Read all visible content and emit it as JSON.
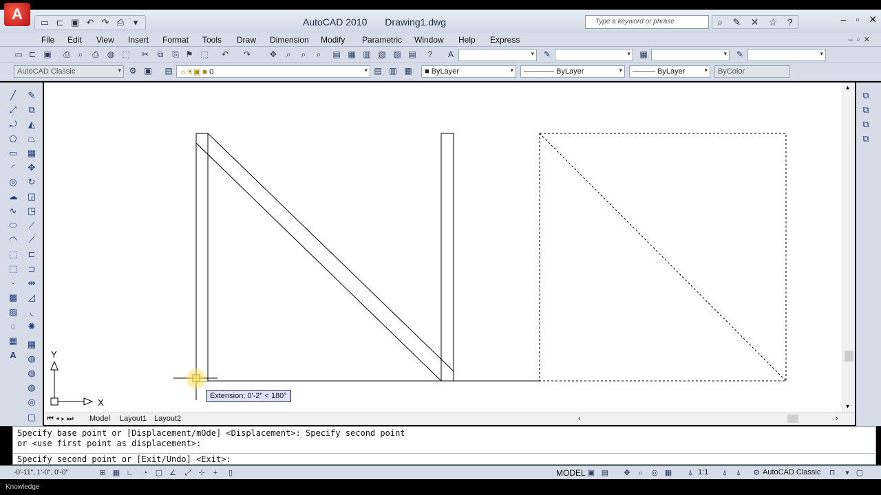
{
  "window": {
    "app_name": "AutoCAD 2010",
    "document": "Drawing1.dwg",
    "search_placeholder": "Type a keyword or phrase"
  },
  "menu": [
    "File",
    "Edit",
    "View",
    "Insert",
    "Format",
    "Tools",
    "Draw",
    "Dimension",
    "Modify",
    "Parametric",
    "Window",
    "Help",
    "Express"
  ],
  "toolbar": {
    "workspace": "AutoCAD Classic",
    "layer": "0",
    "color": "ByLayer",
    "linetype": "ByLayer",
    "lineweight": "ByLayer",
    "plotstyle": "ByColor"
  },
  "drawing": {
    "tooltip": "Extension: 0'-2\" < 180°",
    "ucs_x": "X",
    "ucs_y": "Y"
  },
  "tabs": [
    "Model",
    "Layout1",
    "Layout2"
  ],
  "command": {
    "line1": "Specify base point or [Displacement/mOde] <Displacement>: Specify second point",
    "line2": "or <use first point as displacement>:",
    "prompt": "Specify second point or [Exit/Undo] <Exit>:"
  },
  "status": {
    "coords": "-0'-11\", 1'-0\", 0'-0\"",
    "model": "MODEL",
    "scale": "1:1",
    "workspace": "AutoCAD Classic"
  },
  "taskbar_text": "Knowledge"
}
